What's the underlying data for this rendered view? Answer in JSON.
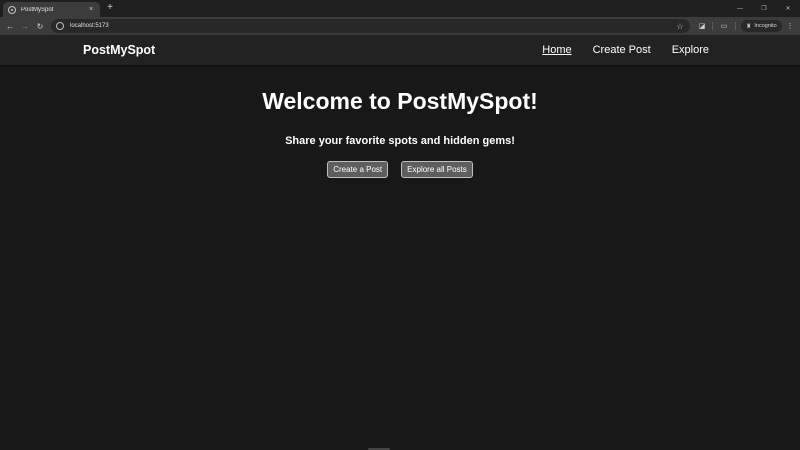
{
  "browser": {
    "tab": {
      "title": "PostMySpot",
      "close_glyph": "×"
    },
    "new_tab_glyph": "+",
    "window_controls": {
      "minimize": "—",
      "restore": "❐",
      "close": "✕"
    },
    "nav": {
      "back": "←",
      "forward": "→",
      "reload": "↻"
    },
    "omnibox": {
      "url": "localhost:5173",
      "star": "☆"
    },
    "toolbar_icons": {
      "extensions": "◪",
      "sidepanel": "▭",
      "profile": "◉",
      "menu": "⋮"
    },
    "incognito": {
      "icon": "♜",
      "label": "Incognito"
    }
  },
  "site": {
    "brand": "PostMySpot",
    "nav": [
      {
        "label": "Home",
        "active": true
      },
      {
        "label": "Create Post",
        "active": false
      },
      {
        "label": "Explore",
        "active": false
      }
    ]
  },
  "hero": {
    "title": "Welcome to PostMySpot!",
    "subtitle": "Share your favorite spots and hidden gems!",
    "buttons": {
      "create": "Create a Post",
      "explore": "Explore all Posts"
    }
  },
  "colors": {
    "background": "#181818",
    "navbar": "#222222",
    "button": "#5e5e5e",
    "button_border": "#bfbfbf",
    "text": "#ffffff"
  }
}
